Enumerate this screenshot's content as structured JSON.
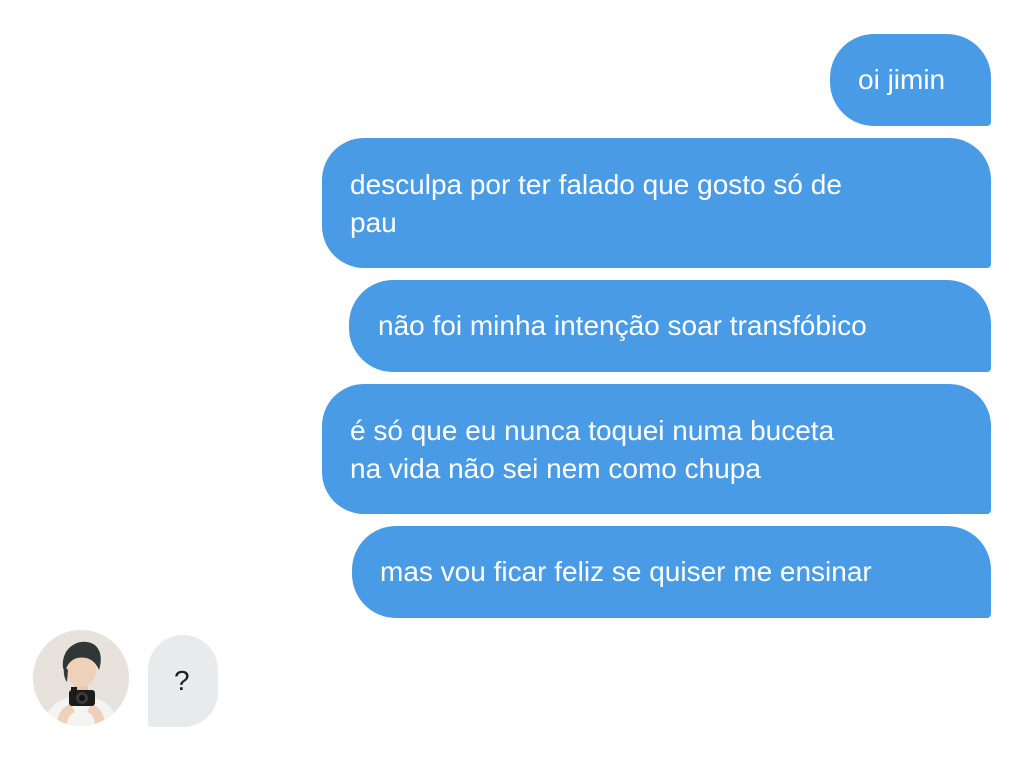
{
  "conversation": {
    "outgoing": [
      "oi jimin",
      "desculpa por ter falado que gosto só de\npau",
      "não foi minha intenção soar transfóbico",
      "é só que eu nunca toquei numa buceta\nna vida não sei nem como chupa",
      "mas vou ficar feliz se quiser me ensinar"
    ],
    "incoming": [
      "?"
    ]
  },
  "colors": {
    "outgoing_bubble": "#4a9be6",
    "outgoing_text": "#ffffff",
    "incoming_bubble": "#e9eaec",
    "incoming_text": "#1e1e1e",
    "background": "#ffffff"
  },
  "icons": {
    "contact_avatar": "avatar-photo-person-with-camera"
  }
}
